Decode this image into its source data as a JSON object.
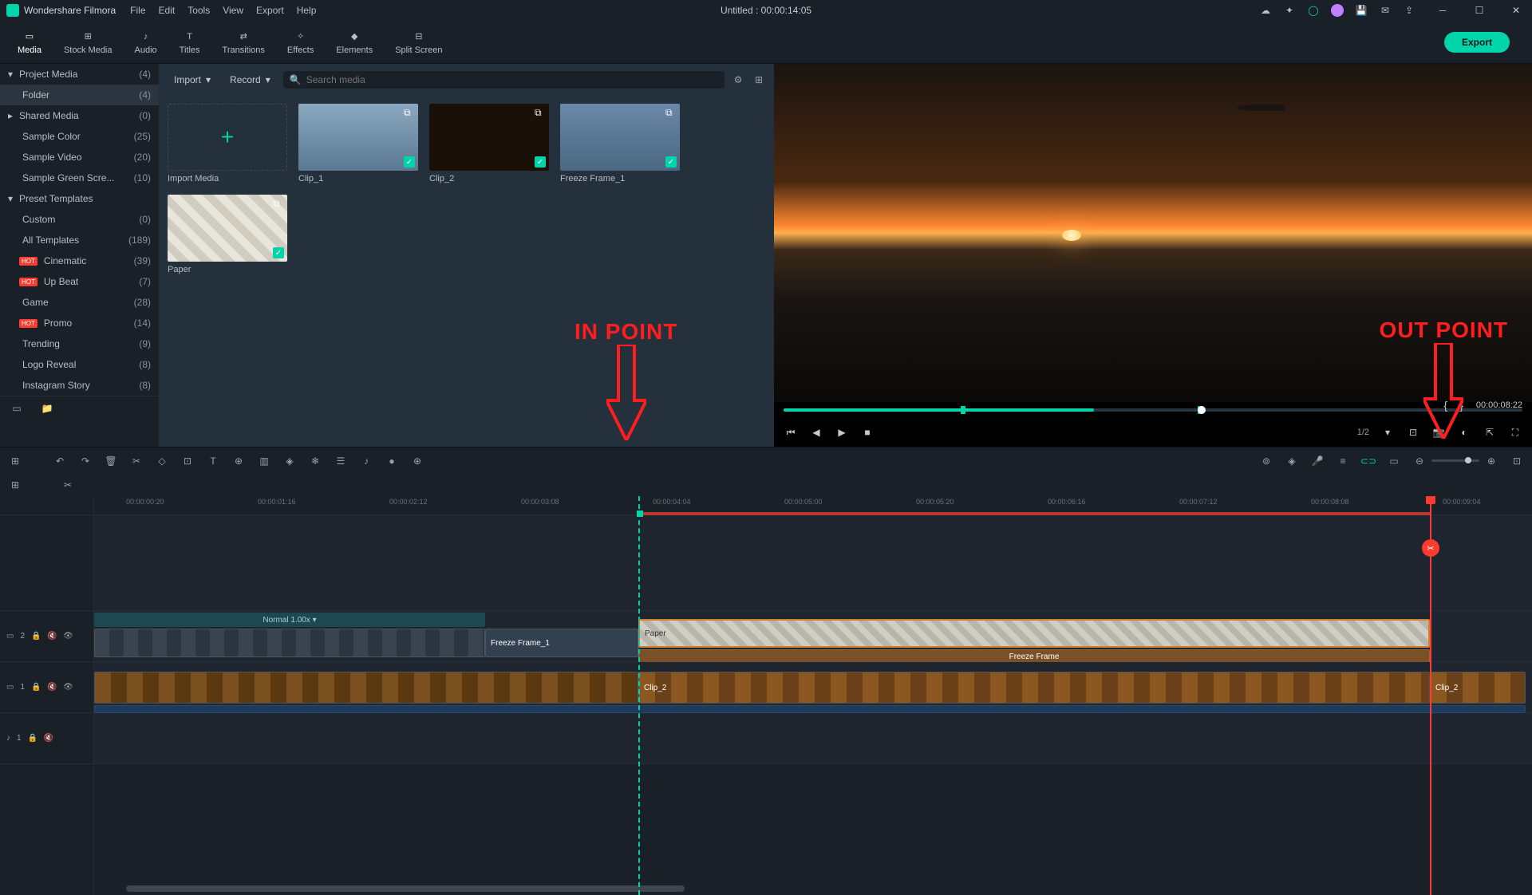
{
  "app": {
    "name": "Wondershare Filmora",
    "doc_title": "Untitled : 00:00:14:05"
  },
  "menu": {
    "file": "File",
    "edit": "Edit",
    "tools": "Tools",
    "view": "View",
    "export": "Export",
    "help": "Help"
  },
  "tabs": {
    "media": "Media",
    "stock": "Stock Media",
    "audio": "Audio",
    "titles": "Titles",
    "transitions": "Transitions",
    "effects": "Effects",
    "elements": "Elements",
    "split": "Split Screen"
  },
  "export_btn": "Export",
  "sidebar": {
    "project_media": {
      "label": "Project Media",
      "count": "(4)"
    },
    "folder": {
      "label": "Folder",
      "count": "(4)"
    },
    "shared_media": {
      "label": "Shared Media",
      "count": "(0)"
    },
    "sample_color": {
      "label": "Sample Color",
      "count": "(25)"
    },
    "sample_video": {
      "label": "Sample Video",
      "count": "(20)"
    },
    "sample_green": {
      "label": "Sample Green Scre...",
      "count": "(10)"
    },
    "preset": {
      "label": "Preset Templates"
    },
    "custom": {
      "label": "Custom",
      "count": "(0)"
    },
    "all_templates": {
      "label": "All Templates",
      "count": "(189)"
    },
    "cinematic": {
      "label": "Cinematic",
      "count": "(39)"
    },
    "upbeat": {
      "label": "Up Beat",
      "count": "(7)"
    },
    "game": {
      "label": "Game",
      "count": "(28)"
    },
    "promo": {
      "label": "Promo",
      "count": "(14)"
    },
    "trending": {
      "label": "Trending",
      "count": "(9)"
    },
    "logo_reveal": {
      "label": "Logo Reveal",
      "count": "(8)"
    },
    "instagram": {
      "label": "Instagram Story",
      "count": "(8)"
    }
  },
  "media_toolbar": {
    "import": "Import",
    "record": "Record",
    "search_placeholder": "Search media"
  },
  "media_items": {
    "import_media": "Import Media",
    "clip1": "Clip_1",
    "clip2": "Clip_2",
    "freeze": "Freeze Frame_1",
    "paper": "Paper"
  },
  "preview": {
    "time": "00:00:08:22",
    "page": "1/2",
    "mark_in": "{",
    "mark_out": "}",
    "in_label": "IN POINT",
    "out_label": "OUT POINT"
  },
  "ruler": [
    "00:00:00:20",
    "00:00:01:16",
    "00:00:02:12",
    "00:00:03:08",
    "00:00:04:04",
    "00:00:05:00",
    "00:00:05:20",
    "00:00:06:16",
    "00:00:07:12",
    "00:00:08:08",
    "00:00:09:04"
  ],
  "timeline": {
    "track2": "2",
    "track1": "1",
    "audio1": "1",
    "normal": "Normal 1.00x ▾",
    "freeze_frame_1": "Freeze Frame_1",
    "paper": "Paper",
    "freeze_frame": "Freeze Frame",
    "clip2": "Clip_2",
    "clip2b": "Clip_2"
  }
}
